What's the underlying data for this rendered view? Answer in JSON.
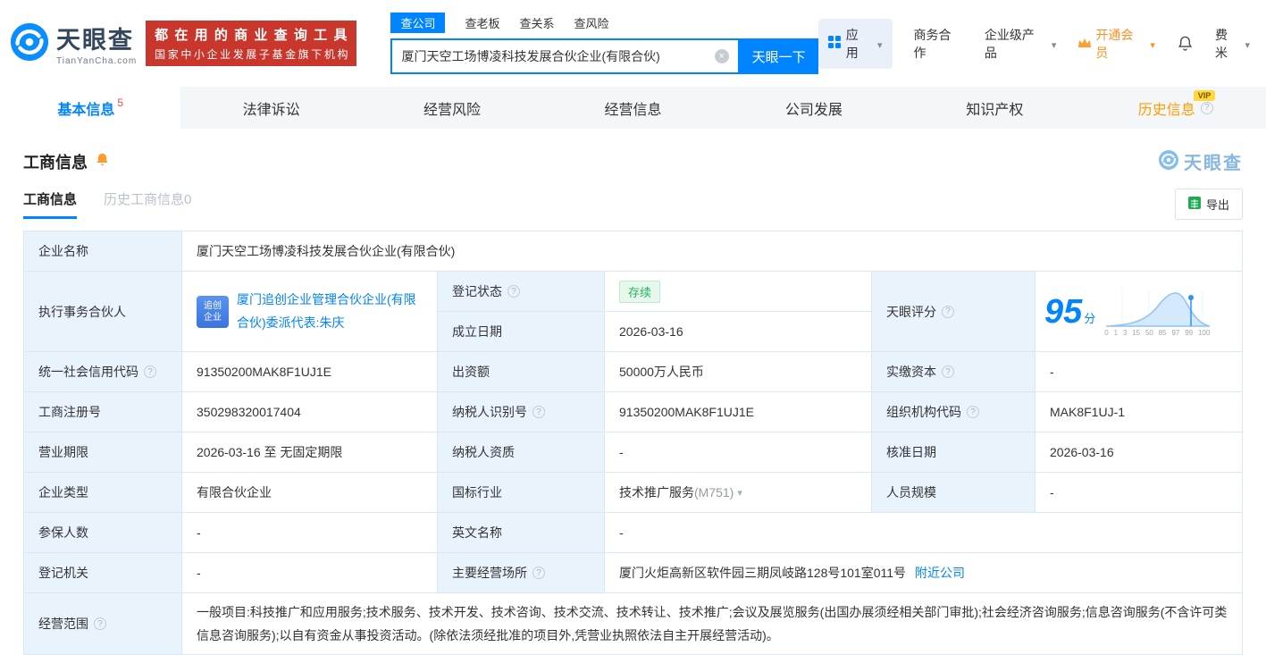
{
  "header": {
    "logo_text": "天眼查",
    "logo_sub": "TianYanCha.com",
    "banner_line1": "都在用的商业查询工具",
    "banner_line2": "国家中小企业发展子基金旗下机构",
    "search_tabs": {
      "company": "查公司",
      "boss": "查老板",
      "relation": "查关系",
      "risk": "查风险"
    },
    "search_value": "厦门天空工场博凌科技发展合伙企业(有限合伙)",
    "search_button": "天眼一下",
    "menu": {
      "apps": "应用",
      "cooperation": "商务合作",
      "enterprise": "企业级产品",
      "vip": "开通会员",
      "user": "费米"
    }
  },
  "nav": {
    "tabs": [
      {
        "label": "基本信息",
        "badge": "5"
      },
      {
        "label": "法律诉讼"
      },
      {
        "label": "经营风险"
      },
      {
        "label": "经营信息"
      },
      {
        "label": "公司发展"
      },
      {
        "label": "知识产权"
      },
      {
        "label": "历史信息",
        "vip": "VIP"
      }
    ]
  },
  "section": {
    "title": "工商信息",
    "watermark": "天眼查",
    "tab_current": "工商信息",
    "tab_history": "历史工商信息0",
    "export_label": "导出"
  },
  "company": {
    "name_label": "企业名称",
    "name_value": "厦门天空工场博凌科技发展合伙企业(有限合伙)",
    "partner_label": "执行事务合伙人",
    "partner_badge_top": "追创",
    "partner_badge_bottom": "企业",
    "partner_value": "厦门追创企业管理合伙企业(有限合伙)委派代表:朱庆",
    "status_label": "登记状态",
    "status_value": "存续",
    "established_label": "成立日期",
    "established_value": "2026-03-16",
    "score_label": "天眼评分",
    "score_value": "95",
    "score_unit": "分",
    "score_axis": [
      "0",
      "1",
      "3",
      "15",
      "50",
      "85",
      "97",
      "99",
      "100"
    ],
    "uscc_label": "统一社会信用代码",
    "uscc_value": "91350200MAK8F1UJ1E",
    "capital_label": "出资额",
    "capital_value": "50000万人民币",
    "paid_label": "实缴资本",
    "paid_value": "-",
    "regno_label": "工商注册号",
    "regno_value": "350298320017404",
    "taxid_label": "纳税人识别号",
    "taxid_value": "91350200MAK8F1UJ1E",
    "orgcode_label": "组织机构代码",
    "orgcode_value": "MAK8F1UJ-1",
    "term_label": "营业期限",
    "term_value": "2026-03-16 至 无固定期限",
    "taxpayer_label": "纳税人资质",
    "taxpayer_value": "-",
    "approved_label": "核准日期",
    "approved_value": "2026-03-16",
    "type_label": "企业类型",
    "type_value": "有限合伙企业",
    "industry_label": "国标行业",
    "industry_value": "技术推广服务",
    "industry_code": "(M751)",
    "staff_label": "人员规模",
    "staff_value": "-",
    "insured_label": "参保人数",
    "insured_value": "-",
    "english_label": "英文名称",
    "english_value": "-",
    "authority_label": "登记机关",
    "authority_value": "-",
    "address_label": "主要经营场所",
    "address_value": "厦门火炬高新区软件园三期凤岐路128号101室011号",
    "nearby_link": "附近公司",
    "scope_label": "经营范围",
    "scope_value": "一般项目:科技推广和应用服务;技术服务、技术开发、技术咨询、技术交流、技术转让、技术推广;会议及展览服务(出国办展须经相关部门审批);社会经济咨询服务;信息咨询服务(不含许可类信息咨询服务);以自有资金从事投资活动。(除依法须经批准的项目外,凭营业执照依法自主开展经营活动)。"
  }
}
